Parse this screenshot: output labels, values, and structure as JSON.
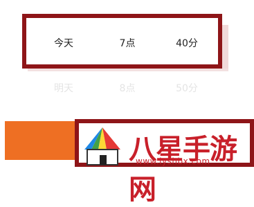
{
  "picker": {
    "selected": {
      "day": "今天",
      "hour": "7点",
      "minute": "40分"
    },
    "next": {
      "day": "明天",
      "hour": "8点",
      "minute": "50分"
    }
  },
  "watermark": {
    "name": "八星手游网",
    "url": "www.lyshbx.com"
  },
  "colors": {
    "highlight_border": "#8e1518",
    "action_bar": "#ee6f23",
    "watermark_text": "#c8202a"
  }
}
